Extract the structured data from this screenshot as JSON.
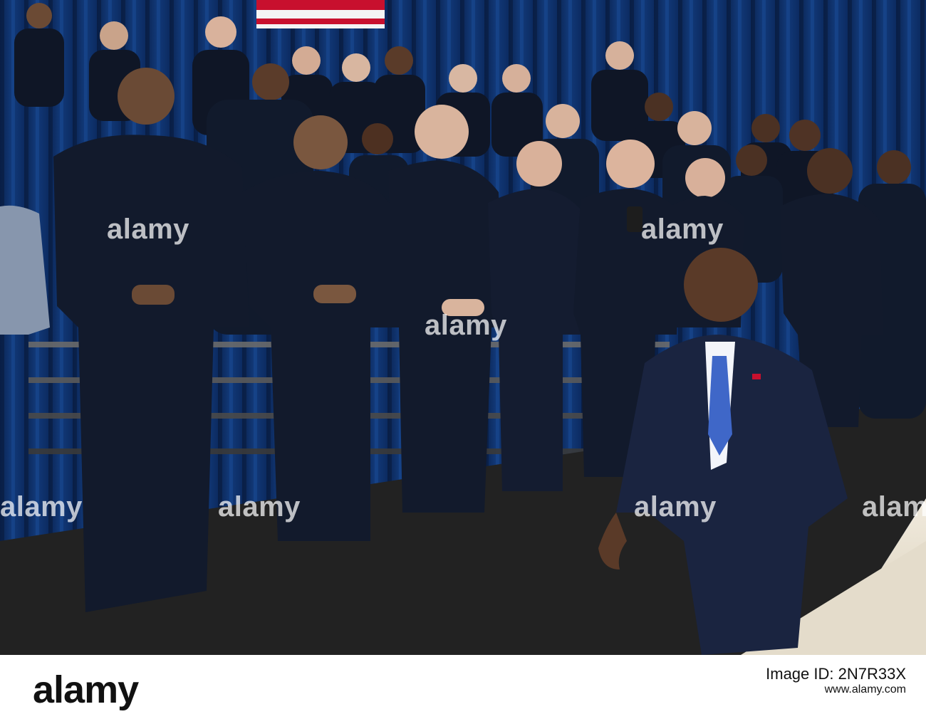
{
  "watermark": "alamy",
  "footer": {
    "brand": "alamy",
    "image_id": "Image ID: 2N7R33X",
    "site": "www.alamy.com"
  },
  "colors": {
    "curtain": "#0b2a5a",
    "uniform": "#121a2b",
    "suit": "#1a2440",
    "stage": "#252525",
    "floor": "#e7dfcf"
  }
}
